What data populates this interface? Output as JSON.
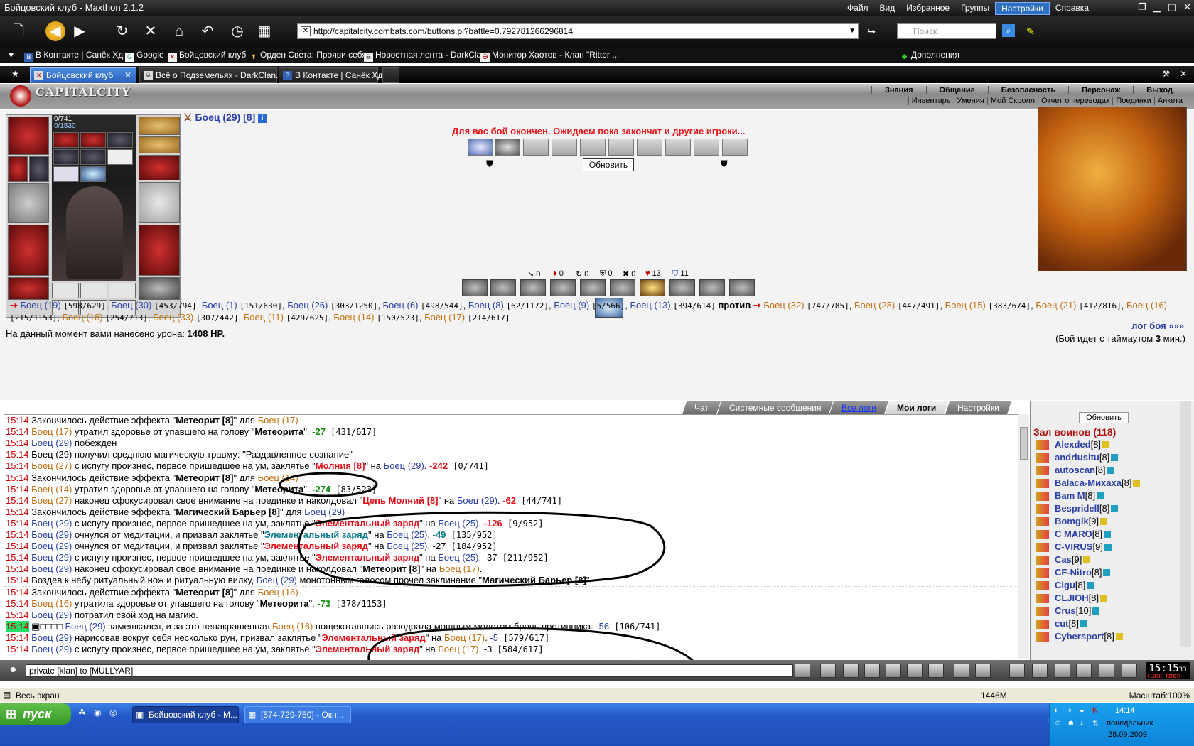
{
  "window": {
    "title": "Бойцовский клуб - Maxthon 2.1.2",
    "menu": [
      "Файл",
      "Вид",
      "Избранное",
      "Группы",
      "Настройки",
      "Справка"
    ],
    "active_menu": "Настройки"
  },
  "toolbar": {
    "url": "http://capitalcity.combats.com/buttons.pl?battle=0.792781266296814",
    "search_placeholder": "Поиск"
  },
  "bookmarks": [
    "В Контакте | Санёк Хд",
    "Google",
    "Бойцовский клуб",
    "Орден Света: Прояви себя",
    "Новостная лента - DarkClan",
    "Монитор Хаотов - Клан \"Ritter ...",
    "Дополнения"
  ],
  "tabs": [
    {
      "label": "Бойцовский клуб",
      "active": true
    },
    {
      "label": "Всё о Подземельях - DarkClan.Ru",
      "active": false
    },
    {
      "label": "В Контакте | Санёк Хд",
      "active": false
    }
  ],
  "game": {
    "logo": "CAPITALCITY",
    "nav_top": [
      "Знания",
      "Общение",
      "Безопасность",
      "Персонаж",
      "Выход"
    ],
    "nav_bottom": [
      "Инвентарь",
      "Умения",
      "Мой Скролл",
      "Отчет о переводах",
      "Поединки",
      "Анкета"
    ],
    "hp": "0/741",
    "mp": "0/1530",
    "fighter": "Боец (29) [8]",
    "battle_message": "Для вас бой окончен. Ожидаем пока закончат и другие игроки...",
    "refresh_label": "Обновить",
    "stats": [
      {
        "icon": "↘",
        "value": "0"
      },
      {
        "icon": "♦",
        "value": "0"
      },
      {
        "icon": "↻",
        "value": "0"
      },
      {
        "icon": "⛨",
        "value": "0"
      },
      {
        "icon": "✖",
        "value": "0"
      },
      {
        "icon": "♥",
        "value": "13"
      },
      {
        "icon": "⛉",
        "value": "11"
      }
    ],
    "team1": [
      {
        "name": "Боец (19)",
        "hp": "[598/629]"
      },
      {
        "name": "Боец (30)",
        "hp": "[453/794]"
      },
      {
        "name": "Боец (1)",
        "hp": "[151/630]"
      },
      {
        "name": "Боец (26)",
        "hp": "[303/1250]"
      },
      {
        "name": "Боец (6)",
        "hp": "[498/544]"
      },
      {
        "name": "Боец (8)",
        "hp": "[62/1172]"
      },
      {
        "name": "Боец (9)",
        "hp": "[5/566]"
      },
      {
        "name": "Боец (13)",
        "hp": "[394/614]"
      }
    ],
    "versus": "против",
    "team2": [
      {
        "name": "Боец (32)",
        "hp": "[747/785]"
      },
      {
        "name": "Боец (28)",
        "hp": "[447/491]"
      },
      {
        "name": "Боец (15)",
        "hp": "[383/674]"
      },
      {
        "name": "Боец (21)",
        "hp": "[412/816]"
      },
      {
        "name": "Боец (16)",
        "hp": "[215/1153]"
      },
      {
        "name": "Боец (18)",
        "hp": "[254/713]"
      },
      {
        "name": "Боец (33)",
        "hp": "[307/442]"
      },
      {
        "name": "Боец (11)",
        "hp": "[429/625]"
      },
      {
        "name": "Боец (14)",
        "hp": "[150/523]"
      },
      {
        "name": "Боец (17)",
        "hp": "[214/617]"
      }
    ],
    "damage_prefix": "На данный момент вами нанесено урона:",
    "damage_value": "1408 HP.",
    "log_link": "лог боя »»»",
    "timeout_text": "(Бой идет с таймаутом",
    "timeout_value": "3",
    "timeout_suffix": "мин.)"
  },
  "chat_tabs": [
    "Чат",
    "Системные сообщения",
    "Все логи",
    "Мои логи",
    "Настройки"
  ],
  "log": [
    {
      "sep": false,
      "p": [
        [
          "tm",
          "15:14"
        ],
        [
          "",
          " Закончилось действие эффекта \""
        ],
        [
          "bold",
          "Метеорит [8]"
        ],
        [
          "",
          "\" для "
        ],
        [
          "o",
          "Боец (17)"
        ]
      ]
    },
    {
      "sep": false,
      "p": [
        [
          "tm",
          "15:14"
        ],
        [
          "o",
          " Боец (17)"
        ],
        [
          "",
          " утратил здоровье от упавшего на голову \""
        ],
        [
          "bold",
          "Метеорита"
        ],
        [
          "",
          "\". "
        ],
        [
          "g",
          "-27"
        ],
        [
          "hpv",
          " [431/617]"
        ]
      ]
    },
    {
      "sep": false,
      "p": [
        [
          "tm",
          "15:14"
        ],
        [
          "b",
          " Боец (29)"
        ],
        [
          "",
          " побежден"
        ]
      ]
    },
    {
      "sep": false,
      "p": [
        [
          "tm",
          "15:14"
        ],
        [
          "",
          " Боец (29) получил среднюю магическую травму: \"Раздавленное сознание\""
        ]
      ]
    },
    {
      "sep": false,
      "p": [
        [
          "tm",
          "15:14"
        ],
        [
          "o",
          " Боец (27)"
        ],
        [
          "",
          " с испугу произнес, первое пришедшее на ум, заклятье \""
        ],
        [
          "r",
          "Молния [8]"
        ],
        [
          "",
          "\" на "
        ],
        [
          "b",
          "Боец (29)"
        ],
        [
          "",
          ". "
        ],
        [
          "r",
          "-242"
        ],
        [
          "hpv",
          " [0/741]"
        ]
      ]
    },
    {
      "sep": true,
      "p": [
        [
          "tm",
          "15:14"
        ],
        [
          "",
          " Закончилось действие эффекта \""
        ],
        [
          "bold",
          "Метеорит [8]"
        ],
        [
          "",
          "\" для "
        ],
        [
          "o",
          "Боец (14)"
        ]
      ]
    },
    {
      "sep": false,
      "p": [
        [
          "tm",
          "15:14"
        ],
        [
          "o",
          " Боец (14)"
        ],
        [
          "",
          " утратил здоровье от упавшего на голову \""
        ],
        [
          "bold",
          "Метеорита"
        ],
        [
          "",
          "\". "
        ],
        [
          "g",
          "-274"
        ],
        [
          "hpv",
          " [83/523]"
        ]
      ]
    },
    {
      "sep": false,
      "p": [
        [
          "tm",
          "15:14"
        ],
        [
          "o",
          " Боец (27)"
        ],
        [
          "",
          " наконец сфокусировал свое внимание на поединке и наколдовал \""
        ],
        [
          "r",
          "Цепь Молний [8]"
        ],
        [
          "",
          "\" на "
        ],
        [
          "b",
          "Боец (29)"
        ],
        [
          "",
          ". "
        ],
        [
          "r",
          "-62"
        ],
        [
          "hpv",
          " [44/741]"
        ]
      ]
    },
    {
      "sep": false,
      "p": [
        [
          "tm",
          "15:14"
        ],
        [
          "",
          " Закончилось действие эффекта \""
        ],
        [
          "bold",
          "Магический Барьер [8]"
        ],
        [
          "",
          "\" для "
        ],
        [
          "b",
          "Боец (29)"
        ]
      ]
    },
    {
      "sep": false,
      "p": [
        [
          "tm",
          "15:14"
        ],
        [
          "b",
          " Боец (29)"
        ],
        [
          "",
          " с испугу произнес, первое пришедшее на ум, заклятье \""
        ],
        [
          "r",
          "Элементальный заряд"
        ],
        [
          "",
          "\" на "
        ],
        [
          "b",
          "Боец (25)"
        ],
        [
          "",
          ". "
        ],
        [
          "r",
          "-126"
        ],
        [
          "hpv",
          " [9/952]"
        ]
      ]
    },
    {
      "sep": false,
      "p": [
        [
          "tm",
          "15:14"
        ],
        [
          "b",
          " Боец (29)"
        ],
        [
          "",
          " очнулся от медитации, и призвал заклятье \""
        ],
        [
          "tq",
          "Элементальный заряд"
        ],
        [
          "",
          "\" на "
        ],
        [
          "b",
          "Боец (25)"
        ],
        [
          "",
          ". "
        ],
        [
          "tq",
          "-49"
        ],
        [
          "hpv",
          " [135/952]"
        ]
      ]
    },
    {
      "sep": false,
      "p": [
        [
          "tm",
          "15:14"
        ],
        [
          "b",
          " Боец (29)"
        ],
        [
          "",
          " очнулся от медитации, и призвал заклятье \""
        ],
        [
          "r",
          "Элементальный заряд"
        ],
        [
          "",
          "\" на "
        ],
        [
          "b",
          "Боец (25)"
        ],
        [
          "",
          ". -27"
        ],
        [
          "hpv",
          " [184/952]"
        ]
      ]
    },
    {
      "sep": false,
      "p": [
        [
          "tm",
          "15:14"
        ],
        [
          "b",
          " Боец (29)"
        ],
        [
          "",
          " с испугу произнес, первое пришедшее на ум, заклятье \""
        ],
        [
          "r",
          "Элементальный заряд"
        ],
        [
          "",
          "\" на "
        ],
        [
          "b",
          "Боец (25)"
        ],
        [
          "",
          ". -37"
        ],
        [
          "hpv",
          " [211/952]"
        ]
      ]
    },
    {
      "sep": false,
      "p": [
        [
          "tm",
          "15:14"
        ],
        [
          "b",
          " Боец (29)"
        ],
        [
          "",
          " наконец сфокусировал свое внимание на поединке и наколдовал \""
        ],
        [
          "bold",
          "Метеорит [8]"
        ],
        [
          "",
          "\" на "
        ],
        [
          "o",
          "Боец (17)"
        ],
        [
          "",
          "."
        ]
      ]
    },
    {
      "sep": false,
      "p": [
        [
          "tm",
          "15:14"
        ],
        [
          "",
          " Воздев к небу ритуальный нож и ритуальную вилку, "
        ],
        [
          "b",
          "Боец (29)"
        ],
        [
          "",
          " монотонным голосом прочел заклинание \""
        ],
        [
          "bold",
          "Магический Барьер [8]"
        ],
        [
          "",
          "\"."
        ]
      ]
    },
    {
      "sep": true,
      "p": [
        [
          "tm",
          "15:14"
        ],
        [
          "",
          " Закончилось действие эффекта \""
        ],
        [
          "bold",
          "Метеорит [8]"
        ],
        [
          "",
          "\" для "
        ],
        [
          "o",
          "Боец (16)"
        ]
      ]
    },
    {
      "sep": false,
      "p": [
        [
          "tm",
          "15:14"
        ],
        [
          "o",
          " Боец (16)"
        ],
        [
          "",
          " утратила здоровье от упавшего на голову \""
        ],
        [
          "bold",
          "Метеорита"
        ],
        [
          "",
          "\". "
        ],
        [
          "g",
          "-73"
        ],
        [
          "hpv",
          " [378/1153]"
        ]
      ]
    },
    {
      "sep": false,
      "p": [
        [
          "tm",
          "15:14"
        ],
        [
          "b",
          " Боец (29)"
        ],
        [
          "",
          " потратил свой ход на магию."
        ]
      ]
    },
    {
      "sep": false,
      "p": [
        [
          "tm hl",
          "15:14"
        ],
        [
          "",
          " ▣□□□□ "
        ],
        [
          "b",
          "Боец (29)"
        ],
        [
          "",
          " замешкался, и за это ненакрашенная "
        ],
        [
          "o",
          "Боец (16)"
        ],
        [
          "",
          " пощекотавшись разодрала мощным молотом бровь противника. "
        ],
        [
          "b",
          "-56"
        ],
        [
          "hpv",
          " [106/741]"
        ]
      ]
    },
    {
      "sep": false,
      "p": [
        [
          "tm",
          "15:14"
        ],
        [
          "b",
          " Боец (29)"
        ],
        [
          "",
          " нарисовав вокруг себя несколько рун, призвал заклятье \""
        ],
        [
          "r",
          "Элементальный заряд"
        ],
        [
          "",
          "\" на "
        ],
        [
          "o",
          "Боец (17)"
        ],
        [
          "",
          ". "
        ],
        [
          "b",
          "-5"
        ],
        [
          "hpv",
          " [579/617]"
        ]
      ]
    },
    {
      "sep": false,
      "p": [
        [
          "tm",
          "15:14"
        ],
        [
          "b",
          " Боец (29)"
        ],
        [
          "",
          " с испугу произнес, первое пришедшее на ум, заклятье \""
        ],
        [
          "r",
          "Элементальный заряд"
        ],
        [
          "",
          "\" на "
        ],
        [
          "o",
          "Боец (17)"
        ],
        [
          "",
          ". -3"
        ],
        [
          "hpv",
          " [584/617]"
        ]
      ]
    }
  ],
  "warriors": {
    "refresh_label": "Обновить",
    "title": "Зал воинов (118)",
    "list": [
      {
        "name": "Alexded",
        "lvl": "[8]"
      },
      {
        "name": "andriusltu",
        "lvl": "[8]"
      },
      {
        "name": "autoscan",
        "lvl": "[8]"
      },
      {
        "name": "Balaca-Mихаха",
        "lvl": "[8]"
      },
      {
        "name": "Bam M",
        "lvl": "[8]"
      },
      {
        "name": "Bespridell",
        "lvl": "[8]"
      },
      {
        "name": "Bomgik",
        "lvl": "[9]"
      },
      {
        "name": "C MARO",
        "lvl": "[8]"
      },
      {
        "name": "C-VIRUS",
        "lvl": "[9]"
      },
      {
        "name": "Cas",
        "lvl": "[9]"
      },
      {
        "name": "CF-Nitro",
        "lvl": "[8]"
      },
      {
        "name": "Cigu",
        "lvl": "[8]"
      },
      {
        "name": "CLJIOH",
        "lvl": "[8]"
      },
      {
        "name": "Crus",
        "lvl": "[10]"
      },
      {
        "name": "cut",
        "lvl": "[8]"
      },
      {
        "name": "Cybersport",
        "lvl": "[8]"
      }
    ]
  },
  "chat_input": "private [klan] to [MULLYAR]",
  "clock": {
    "time": "15:15",
    "sec": "33",
    "labels": "CLOCK  TIMER"
  },
  "statusbar": {
    "left": "Весь экран",
    "mem": "1446M",
    "zoom": "Масштаб:100%"
  },
  "taskbar": {
    "start": "пуск",
    "tasks": [
      "Бойцовский клуб - M...",
      "[574-729-750] - Окн..."
    ],
    "lang": "RU",
    "time": "14:14",
    "day": "понедельник",
    "date": "28.09.2009"
  }
}
